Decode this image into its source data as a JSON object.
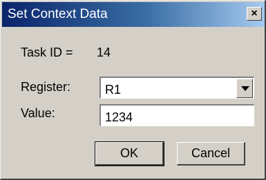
{
  "window": {
    "title": "Set Context Data",
    "close_glyph": "×"
  },
  "task": {
    "label": "Task ID =",
    "value": "14"
  },
  "register": {
    "label": "Register:",
    "selected": "R1"
  },
  "value_field": {
    "label": "Value:",
    "value": "1234"
  },
  "buttons": {
    "ok": "OK",
    "cancel": "Cancel"
  },
  "icons": {
    "close": "close-icon",
    "dropdown": "chevron-down-icon"
  }
}
